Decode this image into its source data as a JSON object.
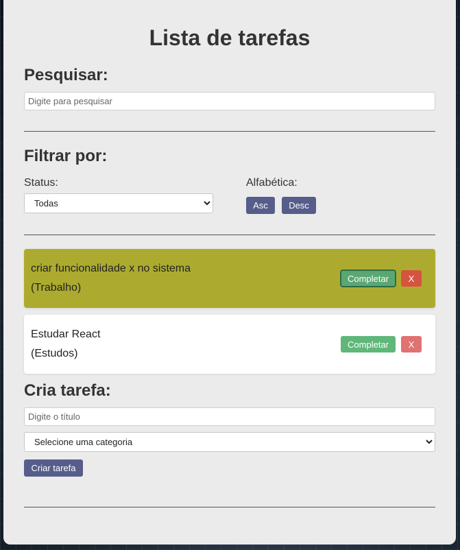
{
  "header": {
    "title": "Lista de tarefas"
  },
  "search": {
    "title": "Pesquisar:",
    "placeholder": "Digite para pesquisar",
    "value": ""
  },
  "filters": {
    "title": "Filtrar por:",
    "status_label": "Status:",
    "status_selected": "Todas",
    "alpha_label": "Alfabética:",
    "asc_label": "Asc",
    "desc_label": "Desc"
  },
  "tasks": [
    {
      "title": "criar funcionalidade x no sistema",
      "category": "(Trabalho)",
      "complete_label": "Completar",
      "remove_label": "X",
      "completed": true
    },
    {
      "title": "Estudar React",
      "category": "(Estudos)",
      "complete_label": "Completar",
      "remove_label": "X",
      "completed": false
    }
  ],
  "create": {
    "title": "Cria tarefa:",
    "title_placeholder": "Digite o título",
    "category_selected": "Selecione uma categoria",
    "submit_label": "Criar tarefa"
  },
  "colors": {
    "panel_bg": "#ebebeb",
    "indigo_button": "#575d8a",
    "completed_task_bg": "#adab2f",
    "complete_button": "#5fb77a",
    "remove_button": "#e07272"
  }
}
